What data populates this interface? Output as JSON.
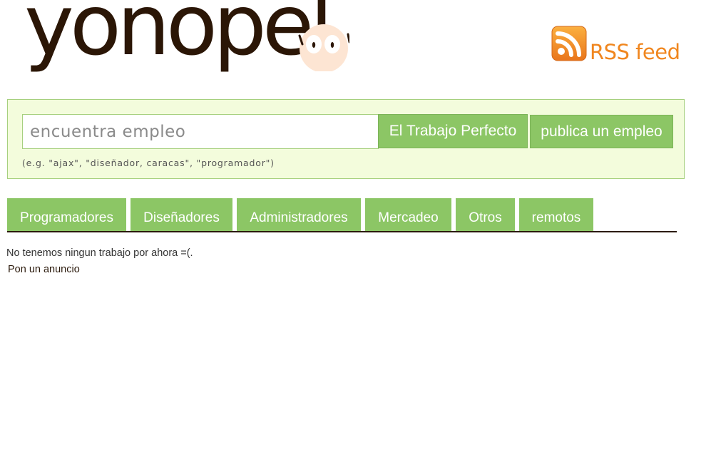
{
  "header": {
    "logo_text": "yonopel",
    "rss_label": "RSS feed",
    "rss_icon": "rss-icon",
    "mascot_icon": "face-icon"
  },
  "search": {
    "placeholder": "encuentra empleo",
    "value": "",
    "search_button": "El Trabajo Perfecto",
    "publish_button": "publica un empleo",
    "hint": "(e.g. \"ajax\", \"diseñador, caracas\", \"programador\")"
  },
  "tabs": [
    {
      "label": "Programadores"
    },
    {
      "label": "Diseñadores"
    },
    {
      "label": "Administradores"
    },
    {
      "label": "Mercadeo"
    },
    {
      "label": "Otros"
    },
    {
      "label": "remotos"
    }
  ],
  "content": {
    "empty_message": "No tenemos ningun trabajo por ahora =(.",
    "post_link": "Pon un anuncio"
  },
  "colors": {
    "accent_green": "#8cc665",
    "panel_bg": "#f3fcdc",
    "logo_brown": "#2b1606",
    "rss_orange": "#f0861e"
  }
}
